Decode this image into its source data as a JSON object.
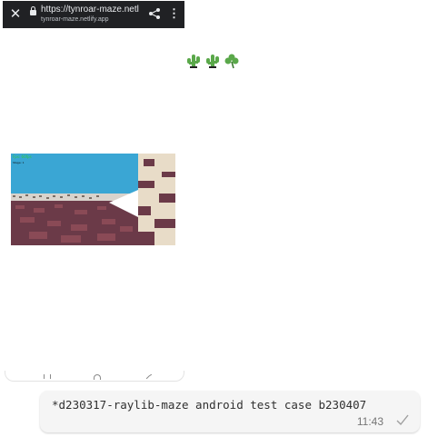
{
  "browser": {
    "close_icon": "close-icon",
    "url": "https://tynroar-maze.netl...",
    "domain": "tynroar-maze.netlify.app",
    "share_icon": "share-icon",
    "menu_icon": "more-vert-icon"
  },
  "clovers": {
    "icons": [
      "cactus-icon",
      "cactus-icon",
      "shamrock-icon"
    ],
    "color": "#5aa84a"
  },
  "game": {
    "fps": "Fps: 60fps",
    "stage": "Stage: 1",
    "colors": {
      "sky": "#3aa6d4",
      "floor": "#6b3a48",
      "wall": "#e8dcc8",
      "fps_text": "#2ecc40"
    }
  },
  "nav_bar": {
    "icons": [
      "recents-icon",
      "home-icon",
      "back-icon"
    ]
  },
  "message": {
    "text": "*d230317-raylib-maze android test case b230407",
    "time": "11:43",
    "status_icon": "checkmark-icon"
  }
}
